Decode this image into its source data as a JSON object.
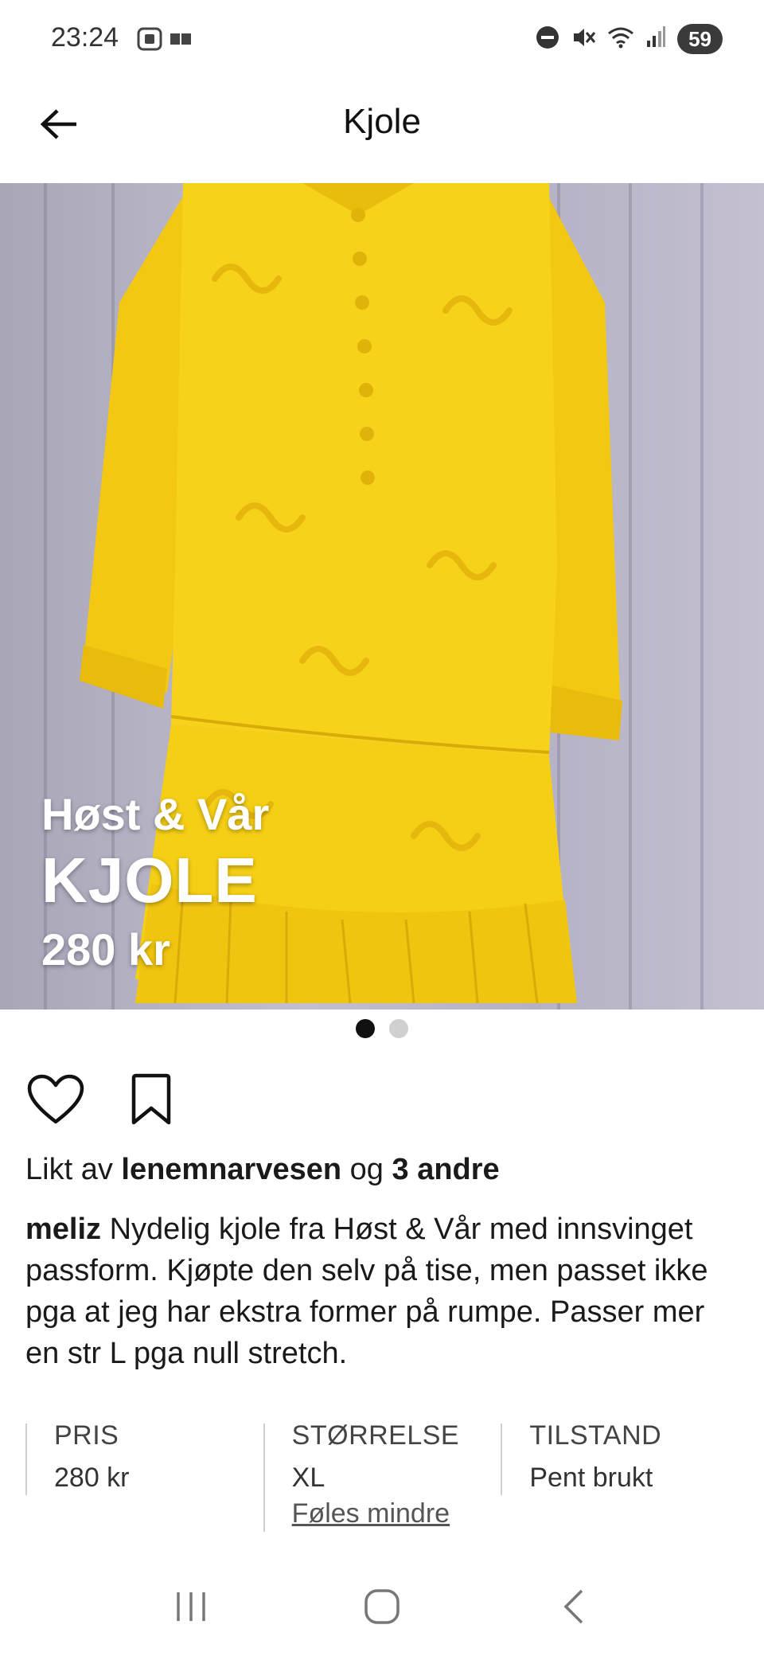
{
  "status_bar": {
    "time": "23:24",
    "battery": "59",
    "icons": [
      "screenshot-icon",
      "media-icon",
      "dnd-icon",
      "mute-icon",
      "wifi-icon",
      "signal-icon"
    ]
  },
  "header": {
    "title": "Kjole",
    "back_icon": "arrow-left-icon"
  },
  "product_image": {
    "overlay_brand": "Høst & Vår",
    "overlay_name": "KJOLE",
    "overlay_price": "280 kr",
    "dress_color": "#f7d21a"
  },
  "carousel": {
    "count": 2,
    "active_index": 0
  },
  "actions": {
    "like_icon": "heart-icon",
    "save_icon": "bookmark-icon"
  },
  "likes": {
    "prefix": "Likt av",
    "user": "lenemnarvesen",
    "connector": "og",
    "others": "3 andre"
  },
  "description": {
    "username": "meliz",
    "text": "Nydelig kjole fra Høst & Vår med innsvinget passform. Kjøpte den selv på tise, men passet ikke pga at jeg har ekstra former på rumpe. Passer mer en str L pga null stretch."
  },
  "info": {
    "price_label": "PRIS",
    "price_value": "280 kr",
    "size_label": "STØRRELSE",
    "size_value": "XL",
    "size_note": "Føles mindre",
    "condition_label": "TILSTAND",
    "condition_value": "Pent brukt"
  },
  "nav": {
    "icons": [
      "recents-icon",
      "home-icon",
      "back-icon"
    ]
  }
}
